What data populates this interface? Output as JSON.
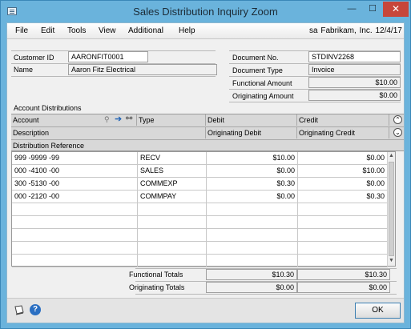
{
  "window": {
    "title": "Sales Distribution Inquiry Zoom",
    "minimize_glyph": "—",
    "maximize_glyph": "☐",
    "close_glyph": "✕"
  },
  "menu": {
    "items": [
      "File",
      "Edit",
      "Tools",
      "View",
      "Additional",
      "Help"
    ],
    "company_info": "sa  Fabrikam, Inc.  12/4/17"
  },
  "header": {
    "customer_id_label": "Customer ID",
    "customer_id_value": "AARONFIT0001",
    "name_label": "Name",
    "name_value": "Aaron Fitz Electrical",
    "document_no_label": "Document No.",
    "document_no_value": "STDINV2268",
    "document_type_label": "Document Type",
    "document_type_value": "Invoice",
    "functional_amount_label": "Functional Amount",
    "functional_amount_value": "$10.00",
    "originating_amount_label": "Originating Amount",
    "originating_amount_value": "$0.00"
  },
  "grid": {
    "section_title": "Account Distributions",
    "header_row1": {
      "account": "Account",
      "type": "Type",
      "debit": "Debit",
      "credit": "Credit"
    },
    "header_row2": {
      "description": "Description",
      "originating_debit": "Originating Debit",
      "originating_credit": "Originating Credit"
    },
    "header_row3": {
      "distribution_reference": "Distribution Reference"
    },
    "rows": [
      {
        "account": "999 -9999 -99",
        "type": "RECV",
        "debit": "$10.00",
        "credit": "$0.00"
      },
      {
        "account": "000 -4100 -00",
        "type": "SALES",
        "debit": "$0.00",
        "credit": "$10.00"
      },
      {
        "account": "300 -5130 -00",
        "type": "COMMEXP",
        "debit": "$0.30",
        "credit": "$0.00"
      },
      {
        "account": "000 -2120 -00",
        "type": "COMMPAY",
        "debit": "$0.00",
        "credit": "$0.30"
      },
      {
        "account": "",
        "type": "",
        "debit": "",
        "credit": ""
      },
      {
        "account": "",
        "type": "",
        "debit": "",
        "credit": ""
      },
      {
        "account": "",
        "type": "",
        "debit": "",
        "credit": ""
      },
      {
        "account": "",
        "type": "",
        "debit": "",
        "credit": ""
      },
      {
        "account": "",
        "type": "",
        "debit": "",
        "credit": ""
      }
    ]
  },
  "totals": {
    "functional_label": "Functional Totals",
    "functional_debit": "$10.30",
    "functional_credit": "$10.30",
    "originating_label": "Originating Totals",
    "originating_debit": "$0.00",
    "originating_credit": "$0.00"
  },
  "footer": {
    "ok_label": "OK",
    "help_glyph": "?"
  },
  "colors": {
    "window_frame": "#6ab3dc",
    "close_button": "#c7463a",
    "ok_border": "#3c7fb1"
  }
}
